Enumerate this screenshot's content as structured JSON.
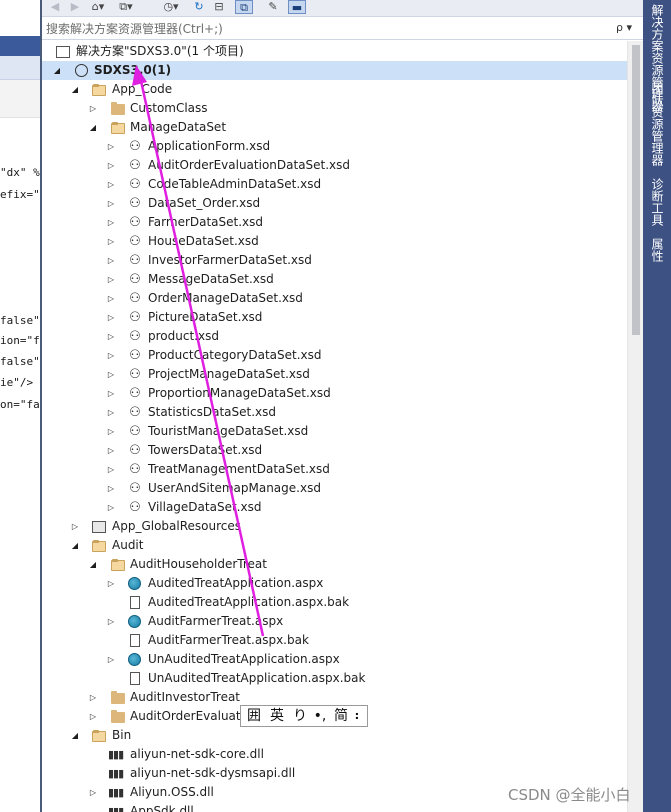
{
  "editor": {
    "fragments": [
      "\"dx\" %",
      "efix=\"c",
      "false\"/>",
      "ion=\"fa",
      "false\"/:",
      "ie\"/>",
      "on=\"fal"
    ]
  },
  "toolbar": {
    "home_icon": "home-icon",
    "sync_icon": "sync-icon",
    "history_icon": "history-icon",
    "refresh_icon": "refresh-icon",
    "properties_icon": "wrench-icon"
  },
  "search": {
    "placeholder": "搜索解决方案资源管理器(Ctrl+;)",
    "icon_label": "ρ ▾"
  },
  "tree": {
    "solution": "解决方案\"SDXS3.0\"(1 个项目)",
    "project": "SDXS3.0(1)",
    "app_code": "App_Code",
    "custom_class": "CustomClass",
    "manage_data_set": "ManageDataSet",
    "xsd_files": [
      "ApplicationForm.xsd",
      "AuditOrderEvaluationDataSet.xsd",
      "CodeTableAdminDataSet.xsd",
      "DataSet_Order.xsd",
      "FarmerDataSet.xsd",
      "HouseDataSet.xsd",
      "InvestorFarmerDataSet.xsd",
      "MessageDataSet.xsd",
      "OrderManageDataSet.xsd",
      "PictureDataSet.xsd",
      "product.xsd",
      "ProductCategoryDataSet.xsd",
      "ProjectManageDataSet.xsd",
      "ProportionManageDataSet.xsd",
      "StatisticsDataSet.xsd",
      "TouristManageDataSet.xsd",
      "TowersDataSet.xsd",
      "TreatManagementDataSet.xsd",
      "UserAndSitemapManage.xsd",
      "VillageDataSet.xsd"
    ],
    "app_global_resources": "App_GlobalResources",
    "audit": "Audit",
    "audit_householder_treat": "AuditHouseholderTreat",
    "audit_files": [
      "AuditedTreatApplication.aspx",
      "AuditedTreatApplication.aspx.bak",
      "AuditFarmerTreat.aspx",
      "AuditFarmerTreat.aspx.bak",
      "UnAuditedTreatApplication.aspx",
      "UnAuditedTreatApplication.aspx.bak"
    ],
    "audit_investor_treat": "AuditInvestorTreat",
    "audit_order_evaluat": "AuditOrderEvaluat",
    "bin": "Bin",
    "bin_files": [
      "aliyun-net-sdk-core.dll",
      "aliyun-net-sdk-dysmsapi.dll",
      "Aliyun.OSS.dll",
      "AppSdk.dll"
    ]
  },
  "right_dock": {
    "tabs": [
      "解决方案资源管理器",
      "团队资源管理器",
      "诊断工具",
      "属性"
    ]
  },
  "ime": {
    "keys": [
      "囲",
      "英",
      "り",
      "•,",
      "简",
      "⠆"
    ]
  },
  "watermark": "CSDN @全能小白",
  "colors": {
    "selection": "#cce0f7",
    "dock": "#3d5283",
    "annotation": "#e020e0"
  }
}
